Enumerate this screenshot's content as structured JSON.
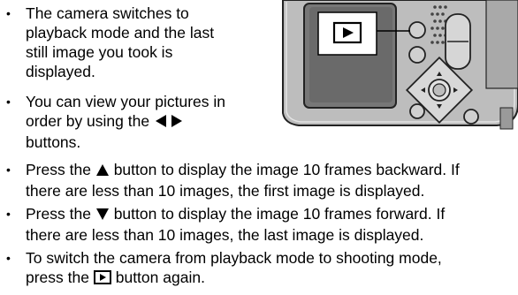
{
  "bullets": [
    {
      "lines": [
        "The camera switches to",
        "playback mode and the last",
        "still image you took is",
        "displayed."
      ]
    },
    {
      "lines": [
        "You can view your pictures in",
        "order by using the",
        "buttons."
      ]
    },
    {
      "lines": [
        "Press the",
        "button to display the image 10 frames backward. If",
        "there are less than 10 images, the first image is displayed."
      ]
    },
    {
      "lines": [
        "Press the",
        "button to display the image 10 frames forward. If",
        "there are less than 10 images, the last image is displayed."
      ]
    },
    {
      "lines": [
        "To switch the camera from playback mode to shooting mode,",
        "press the",
        "button again."
      ]
    }
  ],
  "bullet_char": "•",
  "icons": {
    "left_right": "left-right-arrow-buttons-icon",
    "up": "up-triangle-icon",
    "down": "down-triangle-icon",
    "playback": "playback-button-icon"
  },
  "colors": {
    "text": "#000000",
    "camera_body": "#b8b8b8",
    "camera_dark": "#5a5a5a",
    "screen": "#6f6f6f"
  }
}
